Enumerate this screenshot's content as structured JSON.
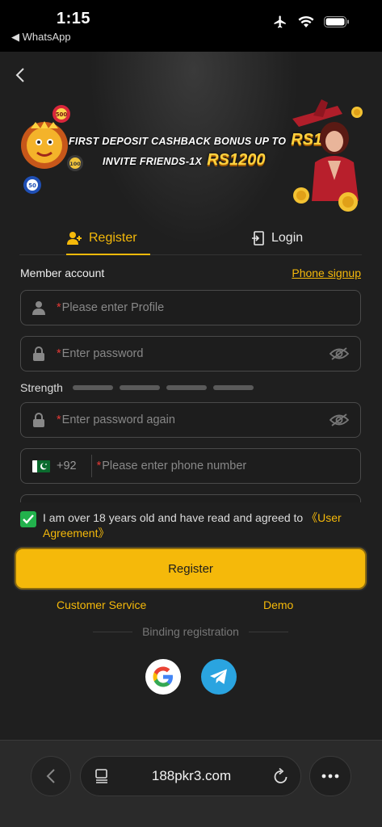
{
  "status_bar": {
    "time": "1:15",
    "back_app": "◀ WhatsApp"
  },
  "banner": {
    "line1_small": "FIRST DEPOSIT CASHBACK BONUS UP TO",
    "line1_big": "RS188",
    "line2_small": "INVITE FRIENDS-1X",
    "line2_big": "RS1200",
    "chip_labels": [
      "500",
      "100",
      "50"
    ]
  },
  "tabs": {
    "register": "Register",
    "login": "Login"
  },
  "form": {
    "section_label": "Member account",
    "phone_signup": "Phone signup",
    "required_mark": "*",
    "profile_placeholder": "Please enter Profile",
    "password_placeholder": "Enter password",
    "strength_label": "Strength",
    "password_again_placeholder": "Enter password again",
    "country_code": "+92",
    "phone_placeholder": "Please enter phone number",
    "agree_text": "I am over 18 years old and have read and agreed to ",
    "agree_link": "《User Agreement》",
    "agree_checked": true,
    "register_button": "Register"
  },
  "links": {
    "customer_service": "Customer Service",
    "demo": "Demo"
  },
  "binding": {
    "label": "Binding registration",
    "providers": [
      "google-icon",
      "telegram-icon"
    ]
  },
  "browser": {
    "url": "188pkr3.com"
  },
  "colors": {
    "accent": "#f5b90a",
    "background": "#1f1f1f",
    "check_green": "#22b14c",
    "telegram_blue": "#2aa4e0",
    "required_red": "#e53935"
  }
}
